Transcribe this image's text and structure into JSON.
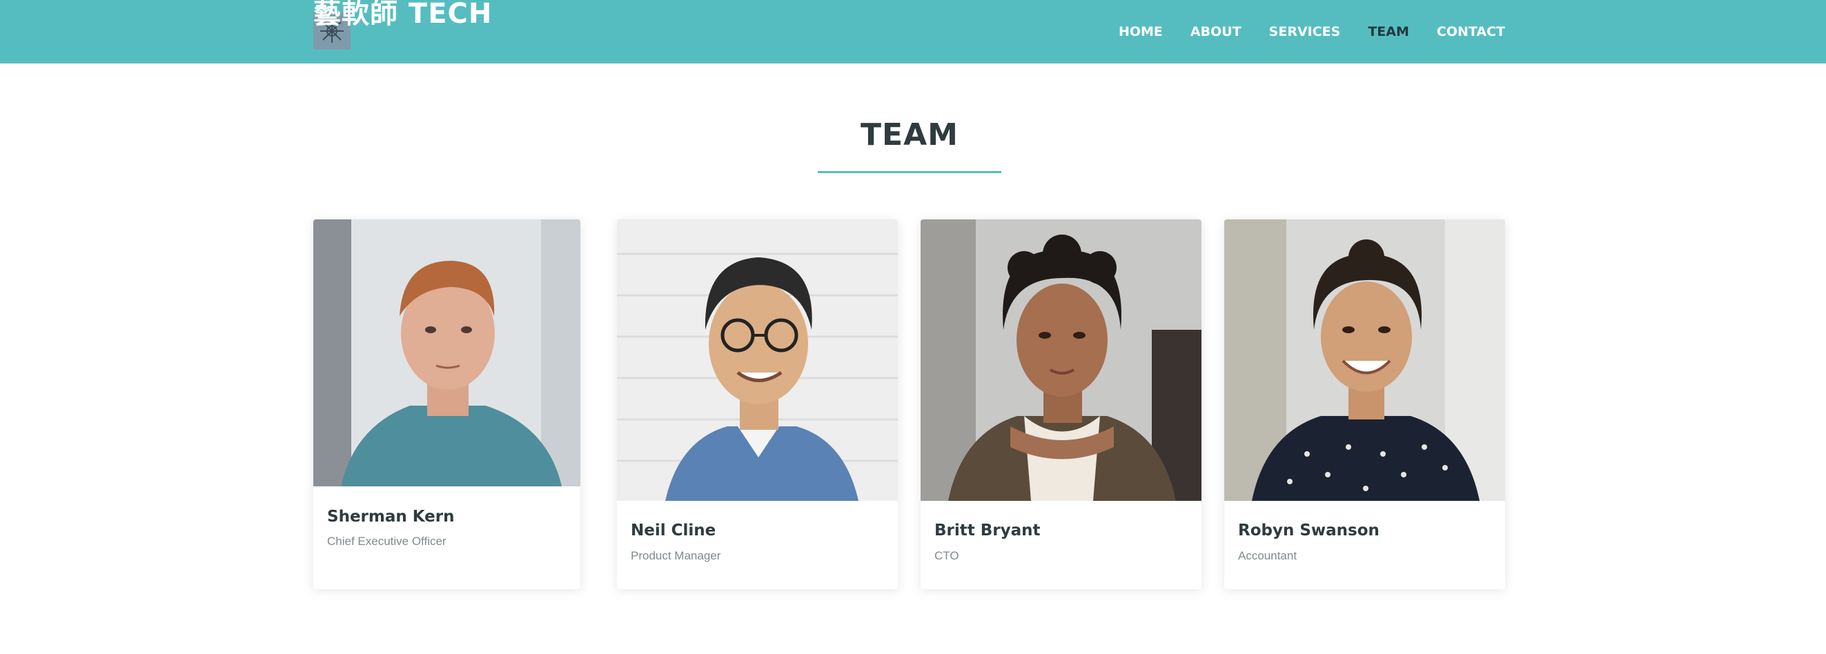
{
  "header": {
    "logo_text": "藝軟師 TECH",
    "logo_icon": "logo-mark-icon",
    "nav": [
      {
        "label": "HOME",
        "active": false
      },
      {
        "label": "ABOUT",
        "active": false
      },
      {
        "label": "SERVICES",
        "active": false
      },
      {
        "label": "TEAM",
        "active": true
      },
      {
        "label": "CONTACT",
        "active": false
      }
    ]
  },
  "section": {
    "title": "TEAM"
  },
  "team": [
    {
      "name": "Sherman Kern",
      "role": "Chief Executive Officer",
      "photo": "portrait-man-teal-sweater"
    },
    {
      "name": "Neil Cline",
      "role": "Product Manager",
      "photo": "portrait-man-glasses-denim"
    },
    {
      "name": "Britt Bryant",
      "role": "CTO",
      "photo": "portrait-woman-curly-hair"
    },
    {
      "name": "Robyn Swanson",
      "role": "Accountant",
      "photo": "portrait-woman-polka-dot"
    }
  ],
  "colors": {
    "header_bg": "#55bdc0",
    "accent": "#55bdc0",
    "title_text": "#2f3b3f",
    "nav_active": "#22383d"
  }
}
